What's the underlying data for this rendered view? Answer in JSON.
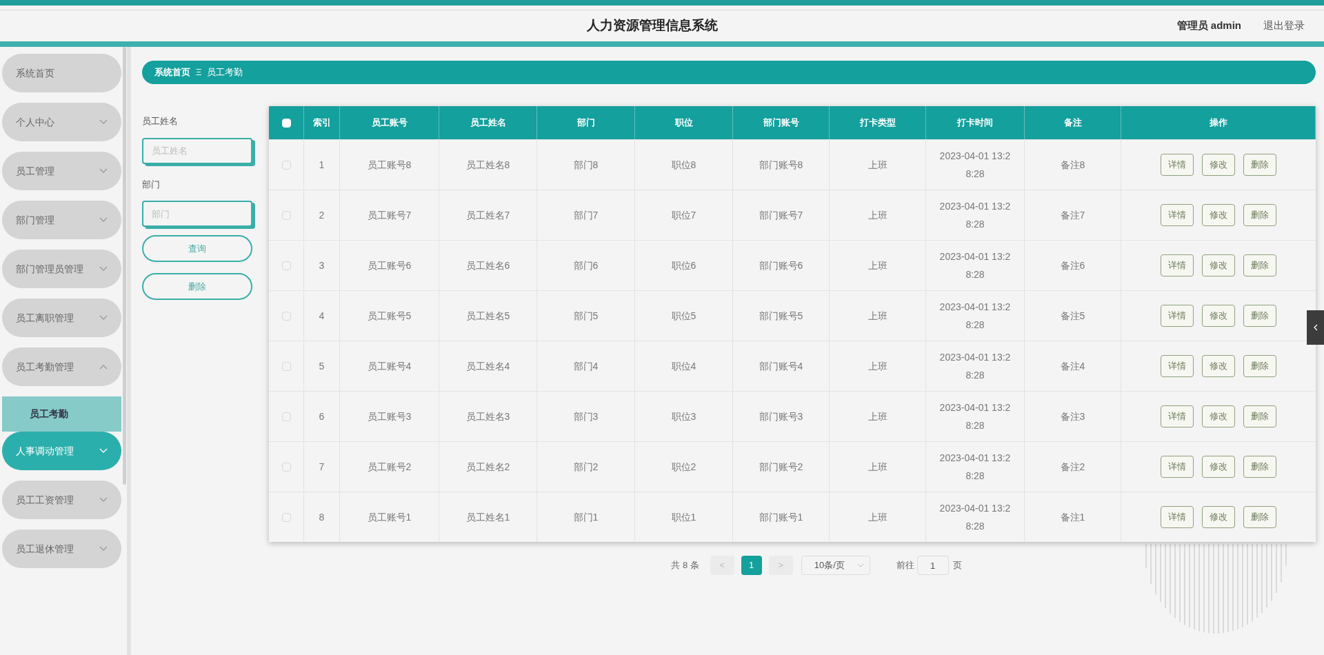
{
  "header": {
    "title": "人力资源管理信息系统",
    "user": "管理员 admin",
    "logout": "退出登录"
  },
  "sidebar": {
    "items": [
      {
        "label": "系统首页",
        "kind": "link",
        "selected": false
      },
      {
        "label": "个人中心",
        "kind": "group",
        "expanded": false,
        "selected": false
      },
      {
        "label": "员工管理",
        "kind": "group",
        "expanded": false,
        "selected": false
      },
      {
        "label": "部门管理",
        "kind": "group",
        "expanded": false,
        "selected": false
      },
      {
        "label": "部门管理员管理",
        "kind": "group",
        "expanded": false,
        "selected": false
      },
      {
        "label": "员工离职管理",
        "kind": "group",
        "expanded": false,
        "selected": false
      },
      {
        "label": "员工考勤管理",
        "kind": "group",
        "expanded": true,
        "selected": false,
        "children": [
          {
            "label": "员工考勤",
            "selected": true
          }
        ]
      },
      {
        "label": "人事调动管理",
        "kind": "group",
        "expanded": false,
        "selected": true
      },
      {
        "label": "员工工资管理",
        "kind": "group",
        "expanded": false,
        "selected": false
      },
      {
        "label": "员工退休管理",
        "kind": "group",
        "expanded": false,
        "selected": false
      }
    ]
  },
  "breadcrumb": [
    "系统首页",
    "员工考勤"
  ],
  "breadcrumb_separator": "Ξ",
  "search": {
    "fields": [
      {
        "label": "员工姓名",
        "placeholder": "员工姓名"
      },
      {
        "label": "部门",
        "placeholder": "部门"
      }
    ],
    "buttons": [
      "查询",
      "删除"
    ]
  },
  "table": {
    "columns": [
      "索引",
      "员工账号",
      "员工姓名",
      "部门",
      "职位",
      "部门账号",
      "打卡类型",
      "打卡时间",
      "备注",
      "操作"
    ],
    "select_all_checked": false,
    "rows": [
      {
        "checked": false,
        "cells": [
          "1",
          "员工账号8",
          "员工姓名8",
          "部门8",
          "职位8",
          "部门账号8",
          "上班",
          "2023-04-01 13:28:28",
          "备注8"
        ],
        "actions": [
          "详情",
          "修改",
          "删除"
        ]
      },
      {
        "checked": false,
        "cells": [
          "2",
          "员工账号7",
          "员工姓名7",
          "部门7",
          "职位7",
          "部门账号7",
          "上班",
          "2023-04-01 13:28:28",
          "备注7"
        ],
        "actions": [
          "详情",
          "修改",
          "删除"
        ]
      },
      {
        "checked": false,
        "cells": [
          "3",
          "员工账号6",
          "员工姓名6",
          "部门6",
          "职位6",
          "部门账号6",
          "上班",
          "2023-04-01 13:28:28",
          "备注6"
        ],
        "actions": [
          "详情",
          "修改",
          "删除"
        ]
      },
      {
        "checked": false,
        "cells": [
          "4",
          "员工账号5",
          "员工姓名5",
          "部门5",
          "职位5",
          "部门账号5",
          "上班",
          "2023-04-01 13:28:28",
          "备注5"
        ],
        "actions": [
          "详情",
          "修改",
          "删除"
        ]
      },
      {
        "checked": false,
        "cells": [
          "5",
          "员工账号4",
          "员工姓名4",
          "部门4",
          "职位4",
          "部门账号4",
          "上班",
          "2023-04-01 13:28:28",
          "备注4"
        ],
        "actions": [
          "详情",
          "修改",
          "删除"
        ]
      },
      {
        "checked": false,
        "cells": [
          "6",
          "员工账号3",
          "员工姓名3",
          "部门3",
          "职位3",
          "部门账号3",
          "上班",
          "2023-04-01 13:28:28",
          "备注3"
        ],
        "actions": [
          "详情",
          "修改",
          "删除"
        ]
      },
      {
        "checked": false,
        "cells": [
          "7",
          "员工账号2",
          "员工姓名2",
          "部门2",
          "职位2",
          "部门账号2",
          "上班",
          "2023-04-01 13:28:28",
          "备注2"
        ],
        "actions": [
          "详情",
          "修改",
          "删除"
        ]
      },
      {
        "checked": false,
        "cells": [
          "8",
          "员工账号1",
          "员工姓名1",
          "部门1",
          "职位1",
          "部门账号1",
          "上班",
          "2023-04-01 13:28:28",
          "备注1"
        ],
        "actions": [
          "详情",
          "修改",
          "删除"
        ]
      }
    ]
  },
  "pagination": {
    "total": "共 8 条",
    "prev": "<",
    "pages": [
      {
        "label": "1",
        "selected": true
      }
    ],
    "next": ">",
    "page_size": "10条/页",
    "goto_label": "前往",
    "goto_value": "1",
    "goto_unit": "页"
  }
}
